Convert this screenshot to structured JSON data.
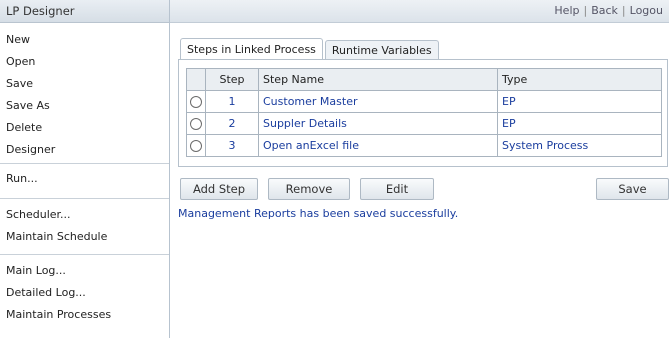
{
  "sidebar": {
    "title": "LP Designer",
    "group1": [
      "New",
      "Open",
      "Save",
      "Save As",
      "Delete",
      "Designer"
    ],
    "group2": [
      "Run..."
    ],
    "group3": [
      "Scheduler...",
      "Maintain Schedule"
    ],
    "group4": [
      "Main Log...",
      "Detailed Log...",
      "Maintain Processes"
    ]
  },
  "top_links": {
    "help": "Help",
    "back": "Back",
    "logout": "Logou"
  },
  "tabs": [
    "Steps in Linked Process",
    "Runtime Variables"
  ],
  "table": {
    "headers": [
      "Step",
      "Step Name",
      "Type"
    ],
    "rows": [
      {
        "step": "1",
        "name": "Customer Master",
        "type": "EP"
      },
      {
        "step": "2",
        "name": "Suppler Details",
        "type": "EP"
      },
      {
        "step": "3",
        "name": "Open anExcel file",
        "type": "System Process"
      }
    ]
  },
  "buttons": {
    "add_step": "Add Step",
    "remove": "Remove",
    "edit": "Edit",
    "save": "Save"
  },
  "status_message": "Management Reports has been saved successfully."
}
